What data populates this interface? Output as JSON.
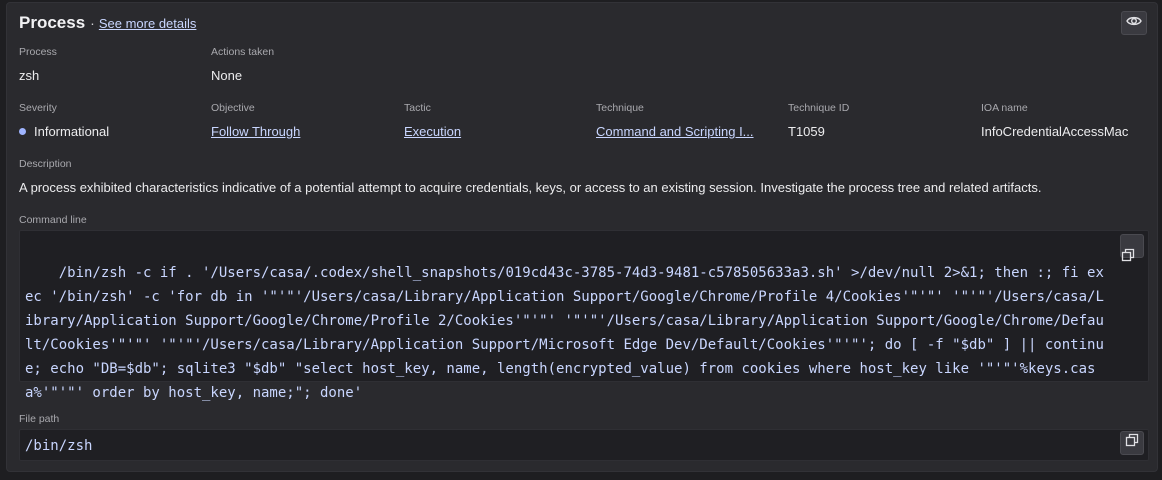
{
  "header": {
    "title": "Process",
    "separator": "·",
    "details_link": "See more details"
  },
  "icons": {
    "eye": "eye-icon",
    "copy": "copy-icon"
  },
  "colors": {
    "accent_link": "#c9d6ff",
    "severity_informational": "#9fb4ff"
  },
  "process": {
    "label": "Process",
    "value": "zsh"
  },
  "actions": {
    "label": "Actions taken",
    "value": "None"
  },
  "severity": {
    "label": "Severity",
    "value": "Informational"
  },
  "objective": {
    "label": "Objective",
    "value": "Follow Through"
  },
  "tactic": {
    "label": "Tactic",
    "value": "Execution"
  },
  "technique": {
    "label": "Technique",
    "value": "Command and Scripting I..."
  },
  "technique_id": {
    "label": "Technique ID",
    "value": "T1059"
  },
  "ioa": {
    "label": "IOA name",
    "value": "InfoCredentialAccessMac"
  },
  "description": {
    "label": "Description",
    "value": "A process exhibited characteristics indicative of a potential attempt to acquire credentials, keys, or access to an existing session. Investigate the process tree and related artifacts."
  },
  "command_line": {
    "label": "Command line",
    "value": "/bin/zsh -c if . '/Users/casa/.codex/shell_snapshots/019cd43c-3785-74d3-9481-c578505633a3.sh' >/dev/null 2>&1; then :; fi exec '/bin/zsh' -c 'for db in '\"'\"'/Users/casa/Library/Application Support/Google/Chrome/Profile 4/Cookies'\"'\"' '\"'\"'/Users/casa/Library/Application Support/Google/Chrome/Profile 2/Cookies'\"'\"' '\"'\"'/Users/casa/Library/Application Support/Google/Chrome/Default/Cookies'\"'\"' '\"'\"'/Users/casa/Library/Application Support/Microsoft Edge Dev/Default/Cookies'\"'\"'; do [ -f \"$db\" ] || continue; echo \"DB=$db\"; sqlite3 \"$db\" \"select host_key, name, length(encrypted_value) from cookies where host_key like '\"'\"'%keys.casa%'\"'\"' order by host_key, name;\"; done'"
  },
  "file_path": {
    "label": "File path",
    "value": "/bin/zsh"
  }
}
